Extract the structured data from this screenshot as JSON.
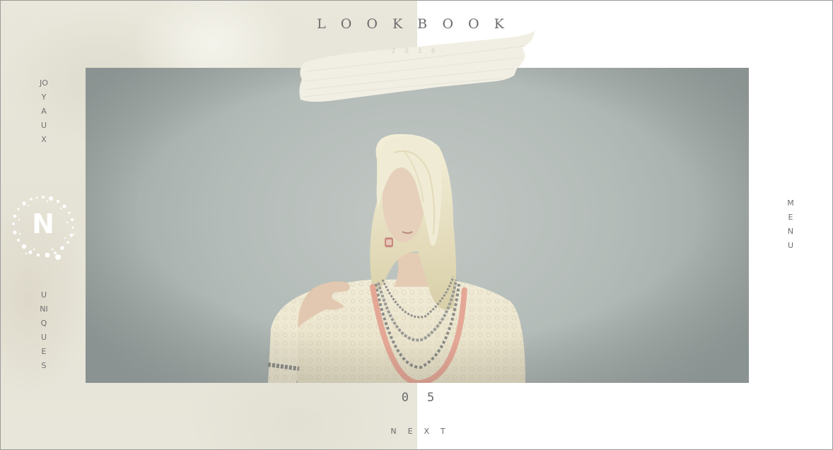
{
  "header": {
    "title": "LOOKBOOK",
    "subtitle": "2016"
  },
  "left_nav": {
    "top_label": "JOYAUX",
    "bottom_label": "UNIQUES",
    "logo_letter": "N"
  },
  "right_nav": {
    "menu_label": "MENU"
  },
  "gallery": {
    "counter": "05",
    "next_label": "NEXT"
  },
  "colors": {
    "text": "#6d6d6d",
    "panel": "#e7e5d9",
    "brush": "#f1efe3",
    "background": "#ffffff"
  }
}
